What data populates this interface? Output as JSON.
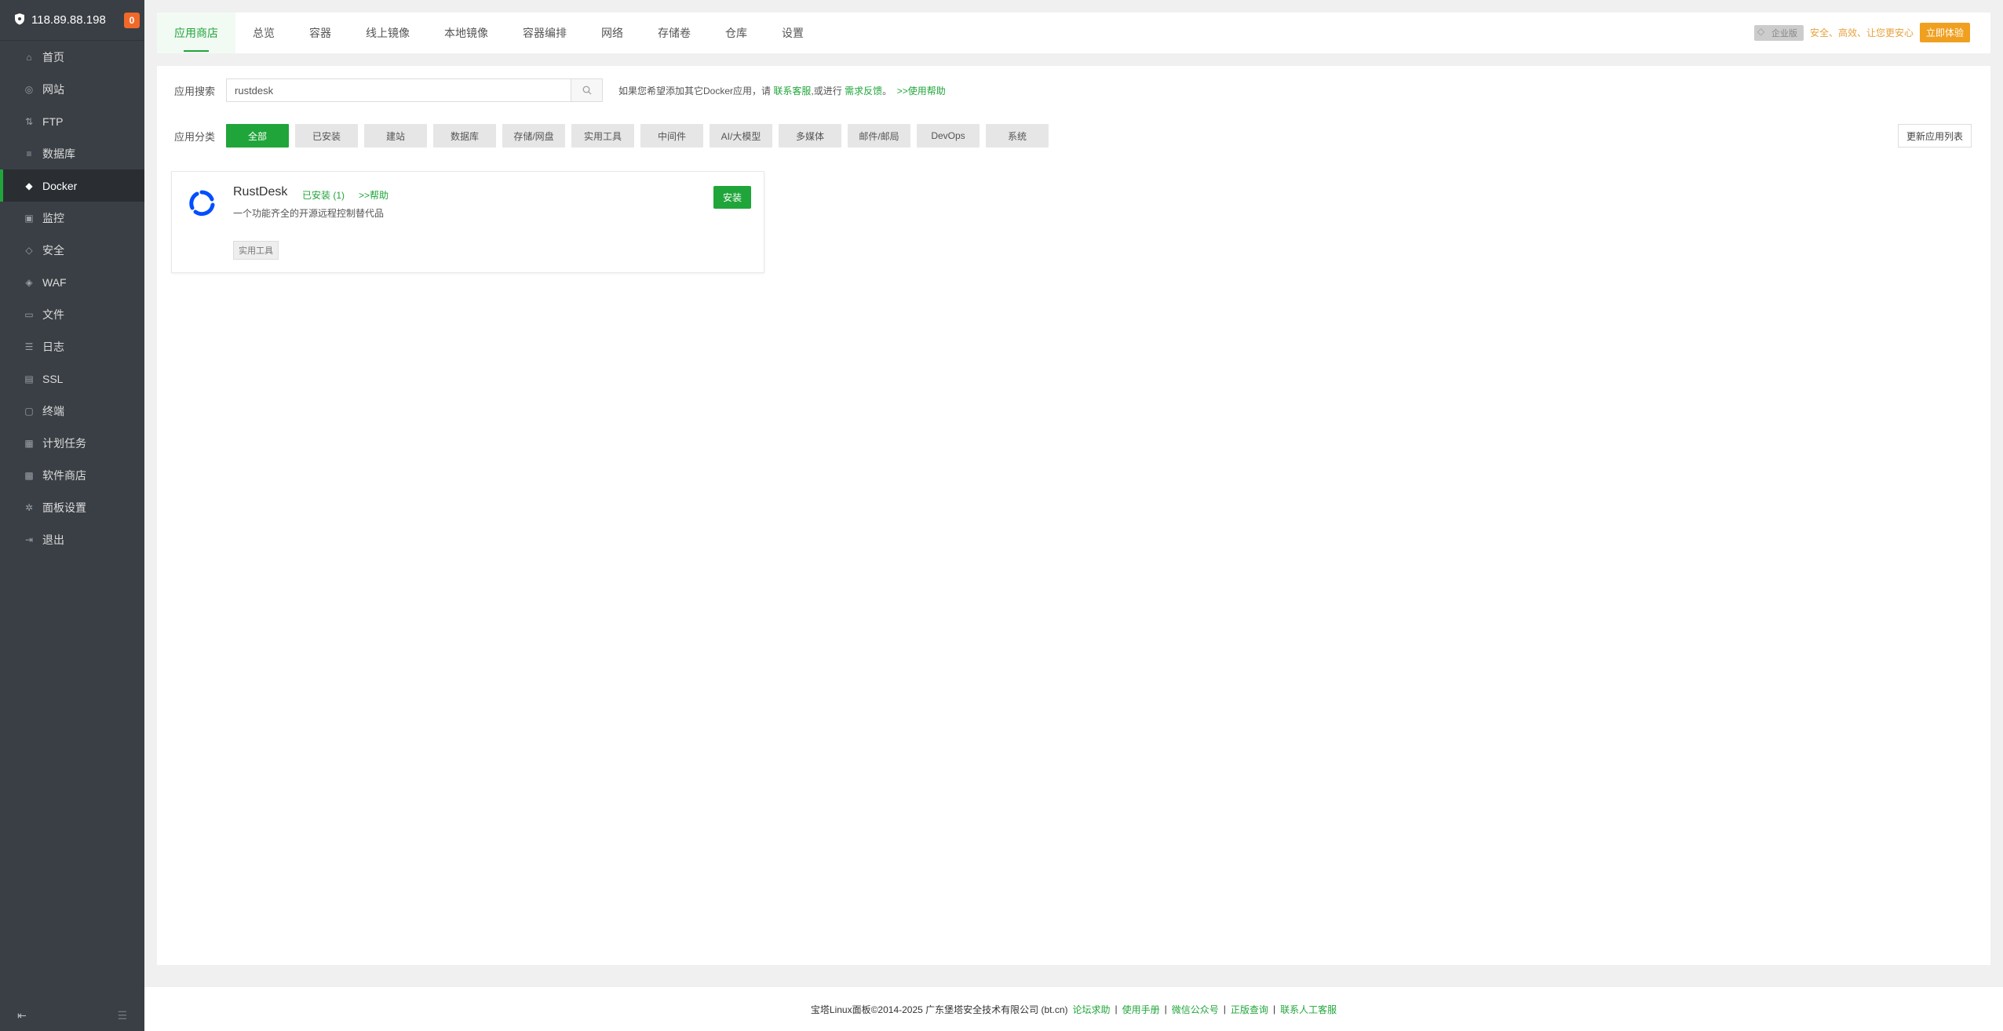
{
  "sidebar": {
    "server_ip": "118.89.88.198",
    "badge_count": "0",
    "items": [
      {
        "label": "首页",
        "icon": "home-icon"
      },
      {
        "label": "网站",
        "icon": "globe-icon"
      },
      {
        "label": "FTP",
        "icon": "ftp-icon"
      },
      {
        "label": "数据库",
        "icon": "database-icon"
      },
      {
        "label": "Docker",
        "icon": "docker-icon"
      },
      {
        "label": "监控",
        "icon": "monitor-icon"
      },
      {
        "label": "安全",
        "icon": "shield-icon"
      },
      {
        "label": "WAF",
        "icon": "waf-icon"
      },
      {
        "label": "文件",
        "icon": "folder-icon"
      },
      {
        "label": "日志",
        "icon": "log-icon"
      },
      {
        "label": "SSL",
        "icon": "ssl-icon"
      },
      {
        "label": "终端",
        "icon": "terminal-icon"
      },
      {
        "label": "计划任务",
        "icon": "schedule-icon"
      },
      {
        "label": "软件商店",
        "icon": "store-icon"
      },
      {
        "label": "面板设置",
        "icon": "gear-icon"
      },
      {
        "label": "退出",
        "icon": "logout-icon"
      }
    ],
    "active_index": 4
  },
  "tabs": [
    {
      "label": "应用商店"
    },
    {
      "label": "总览"
    },
    {
      "label": "容器"
    },
    {
      "label": "线上镜像"
    },
    {
      "label": "本地镜像"
    },
    {
      "label": "容器编排"
    },
    {
      "label": "网络"
    },
    {
      "label": "存储卷"
    },
    {
      "label": "仓库"
    },
    {
      "label": "设置"
    }
  ],
  "promo": {
    "edition": "企业版",
    "slogan": "安全、高效、让您更安心",
    "try_label": "立即体验"
  },
  "search": {
    "label": "应用搜索",
    "value": "rustdesk",
    "tip_prefix": "如果您希望添加其它Docker应用，请",
    "tip_link1": "联系客服",
    "tip_middle": ",或进行",
    "tip_link2": "需求反馈",
    "tip_suffix": "。",
    "tip_help": ">>使用帮助"
  },
  "categories": {
    "label": "应用分类",
    "items": [
      "全部",
      "已安装",
      "建站",
      "数据库",
      "存储/网盘",
      "实用工具",
      "中间件",
      "AI/大模型",
      "多媒体",
      "邮件/邮局",
      "DevOps",
      "系统"
    ],
    "active_index": 0,
    "refresh_label": "更新应用列表"
  },
  "app_card": {
    "name": "RustDesk",
    "installed": "已安装 (1)",
    "help": ">>帮助",
    "description": "一个功能齐全的开源远程控制替代品",
    "tag": "实用工具",
    "install_label": "安装"
  },
  "footer": {
    "copyright": "宝塔Linux面板©2014-2025 广东堡塔安全技术有限公司 (bt.cn)",
    "links": [
      "论坛求助",
      "使用手册",
      "微信公众号",
      "正版查询",
      "联系人工客服"
    ]
  },
  "colors": {
    "accent": "#20a53a",
    "sidebar_bg": "#3a3f45",
    "badge": "#f0692a",
    "promo": "#f0a020"
  }
}
